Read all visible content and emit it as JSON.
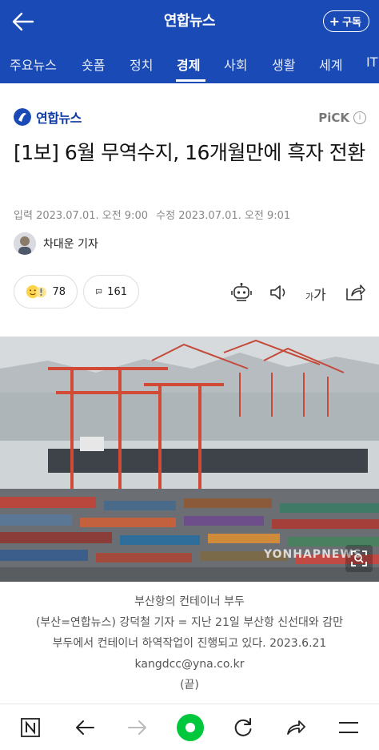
{
  "header": {
    "title": "연합뉴스",
    "subscribe_label": "구독",
    "icons": [
      "back-arrow-icon",
      "plus-icon"
    ]
  },
  "tabs": [
    {
      "label": "주요뉴스",
      "active": false
    },
    {
      "label": "숏폼",
      "active": false
    },
    {
      "label": "정치",
      "active": false
    },
    {
      "label": "경제",
      "active": true
    },
    {
      "label": "사회",
      "active": false
    },
    {
      "label": "생활",
      "active": false
    },
    {
      "label": "세계",
      "active": false
    },
    {
      "label": "IT",
      "active": false
    }
  ],
  "article": {
    "press_name": "연합뉴스",
    "pick_label": "PiCK",
    "headline": "[1보] 6월 무역수지, 16개월만에 흑자 전환",
    "input_label": "입력",
    "input_date": "2023.07.01. 오전 9:00",
    "modified_label": "수정",
    "modified_date": "2023.07.01. 오전 9:01",
    "reporter": "차대운 기자",
    "reaction_count": "78",
    "comment_count": "161",
    "font_size_label_small": "가",
    "font_size_label_large": "가"
  },
  "photo": {
    "watermark": "YONHAPNEWS",
    "caption_lines": [
      "부산항의 컨테이너 부두",
      "(부산=연합뉴스) 강덕철 기자 = 지난 21일 부산항 신선대와 감만",
      "부두에서 컨테이너 하역작업이 진행되고 있다. 2023.6.21",
      "kangdcc@yna.co.kr",
      "(끝)"
    ]
  },
  "colors": {
    "brand_blue": "#1a4ab5",
    "accent_green": "#00c73c"
  }
}
